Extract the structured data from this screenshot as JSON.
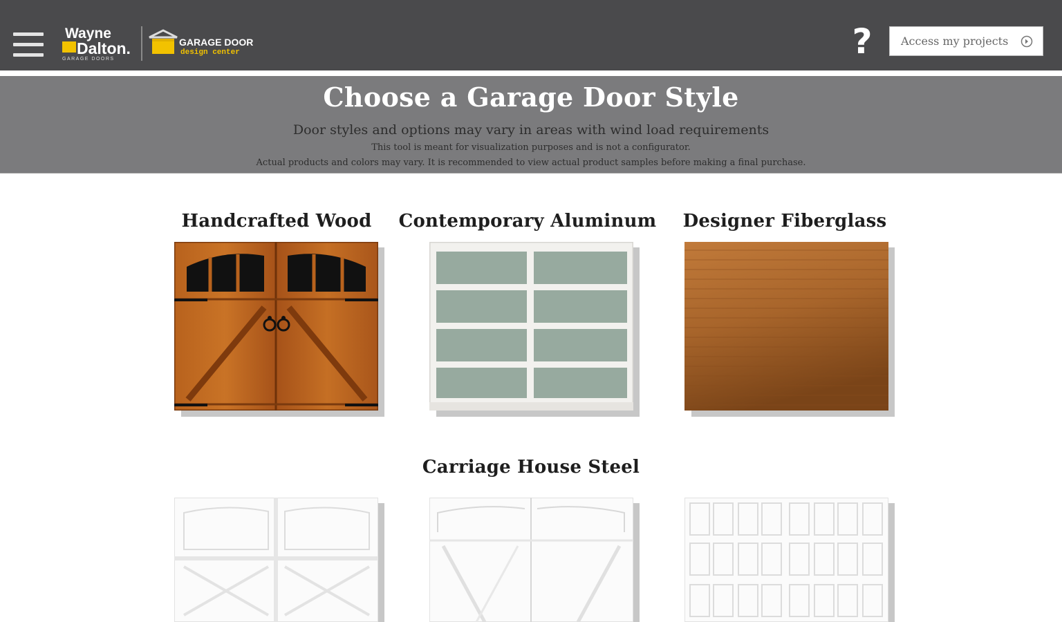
{
  "header": {
    "menu_icon": "hamburger-menu-icon",
    "logo_text": "Wayne Dalton GARAGE DOORS",
    "app_logo_text": "GARAGE DOOR design center",
    "help_label": "?",
    "access_button_label": "Access my projects",
    "access_button_icon": "arrow-circle-icon"
  },
  "banner": {
    "title": "Choose a Garage Door Style",
    "subtitle": "Door styles and options may vary in areas with wind load requirements",
    "note1": "This tool is meant for visualization purposes and is not a configurator.",
    "note2": "Actual products and colors may vary. It is recommended to view actual product samples before making a final purchase."
  },
  "categories": [
    {
      "title": "Handcrafted Wood"
    },
    {
      "title": "Contemporary Aluminum"
    },
    {
      "title": "Designer Fiberglass"
    },
    {
      "title": "Carriage House Steel"
    }
  ],
  "colors": {
    "topbar": "#4a4a4c",
    "banner": "#7b7b7d",
    "brand_yellow": "#f2c200"
  }
}
